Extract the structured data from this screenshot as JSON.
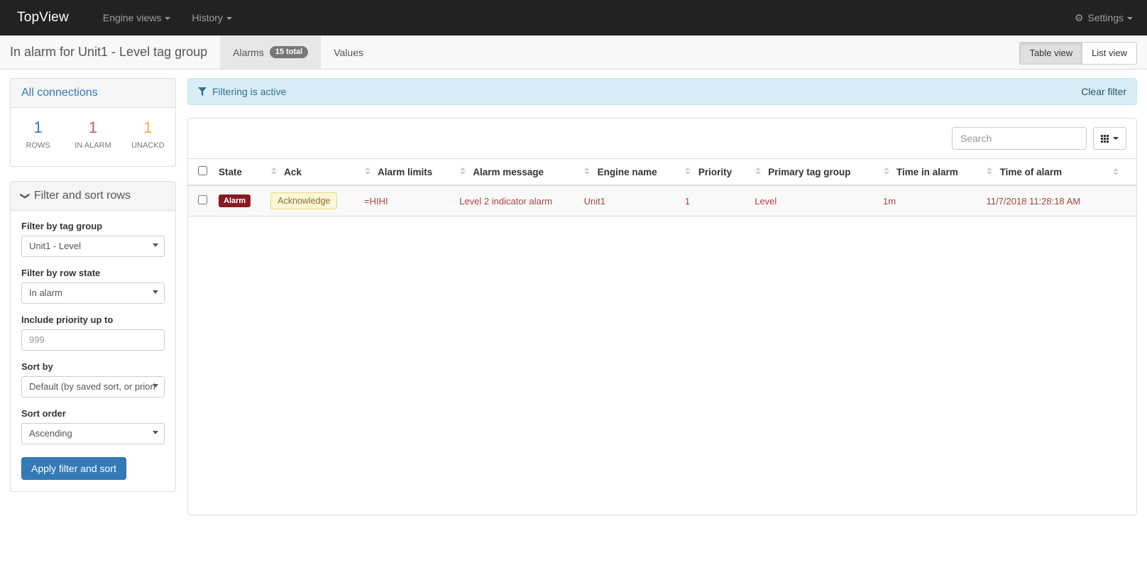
{
  "navbar": {
    "brand": "TopView",
    "links": [
      {
        "label": "Engine views",
        "caret": true
      },
      {
        "label": "History",
        "caret": true
      }
    ],
    "settings": {
      "label": "Settings",
      "icon": "gear-icon",
      "caret": true
    }
  },
  "titlebar": {
    "page_title": "In alarm for Unit1 - Level tag group",
    "tabs": [
      {
        "label": "Alarms",
        "badge": "15 total",
        "active": true
      },
      {
        "label": "Values",
        "badge": "",
        "active": false
      }
    ],
    "view_toggle": [
      {
        "label": "Table view",
        "active": true
      },
      {
        "label": "List view",
        "active": false
      }
    ]
  },
  "sidebar": {
    "connections": {
      "title": "All connections",
      "stats": [
        {
          "value": "1",
          "label": "ROWS",
          "color": "#337ab7"
        },
        {
          "value": "1",
          "label": "IN ALARM",
          "color": "#d9534f"
        },
        {
          "value": "1",
          "label": "UNACKD",
          "color": "#f0ad4e"
        }
      ]
    },
    "filter_panel": {
      "title": "Filter and sort rows",
      "chevron": "chevron-down-icon",
      "fields": [
        {
          "label": "Filter by tag group",
          "value": "Unit1 - Level",
          "type": "select"
        },
        {
          "label": "Filter by row state",
          "value": "In alarm",
          "type": "select"
        },
        {
          "label": "Include priority up to",
          "value": "999",
          "type": "text"
        },
        {
          "label": "Sort by",
          "value": "Default (by saved sort, or priori",
          "type": "select"
        },
        {
          "label": "Sort order",
          "value": "Ascending",
          "type": "select"
        }
      ],
      "apply_label": "Apply filter and sort"
    }
  },
  "content": {
    "alert": {
      "icon": "filter-funnel-icon",
      "message": "Filtering is active",
      "clear_label": "Clear filter"
    },
    "toolbar": {
      "search_placeholder": "Search",
      "search_value": "",
      "grid_icon": "grid-columns-icon"
    },
    "table": {
      "columns": [
        "State",
        "Ack",
        "Alarm limits",
        "Alarm message",
        "Engine name",
        "Priority",
        "Primary tag group",
        "Time in alarm",
        "Time of alarm"
      ],
      "rows": [
        {
          "state": "Alarm",
          "ack": "Acknowledge",
          "alarm_limits": "=HIHI",
          "alarm_message": "Level 2 indicator alarm",
          "engine_name": "Unit1",
          "priority": "1",
          "primary_tag_group": "Level",
          "time_in_alarm": "1m",
          "time_of_alarm": "11/7/2018 11:28:18 AM"
        }
      ]
    }
  }
}
